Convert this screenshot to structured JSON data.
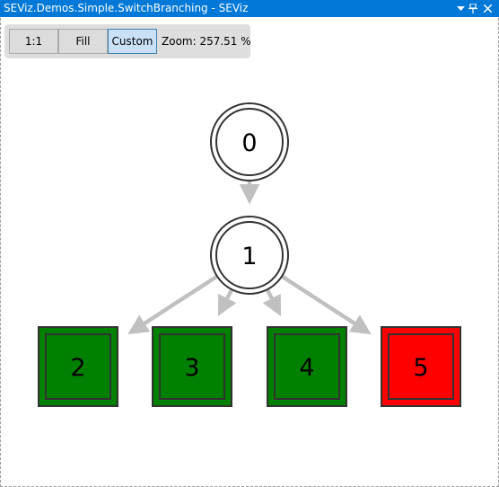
{
  "window": {
    "title": "SEViz.Demos.Simple.SwitchBranching - SEViz"
  },
  "toolbar": {
    "btn_1to1": "1:1",
    "btn_fill": "Fill",
    "btn_custom": "Custom",
    "zoom_text": "Zoom: 257.51 %"
  },
  "graph": {
    "nodes": [
      {
        "id": "0",
        "shape": "double-circle",
        "fill": "#ffffff"
      },
      {
        "id": "1",
        "shape": "double-circle",
        "fill": "#ffffff"
      },
      {
        "id": "2",
        "shape": "double-square",
        "fill": "#008000"
      },
      {
        "id": "3",
        "shape": "double-square",
        "fill": "#008000"
      },
      {
        "id": "4",
        "shape": "double-square",
        "fill": "#008000"
      },
      {
        "id": "5",
        "shape": "double-square",
        "fill": "#ff0000"
      }
    ],
    "edges": [
      {
        "from": "0",
        "to": "1"
      },
      {
        "from": "1",
        "to": "2"
      },
      {
        "from": "1",
        "to": "3"
      },
      {
        "from": "1",
        "to": "4"
      },
      {
        "from": "1",
        "to": "5"
      }
    ],
    "colors": {
      "edge": "#c0c0c0",
      "stroke": "#333333"
    }
  }
}
